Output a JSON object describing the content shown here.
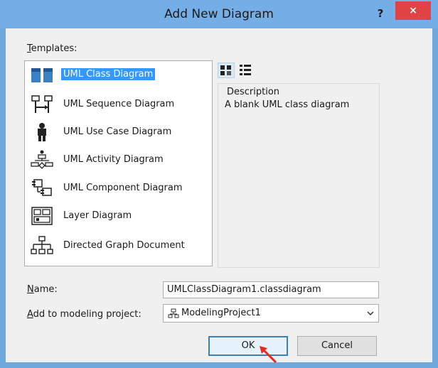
{
  "window": {
    "title": "Add New Diagram",
    "help": "?",
    "close": "×"
  },
  "templates": {
    "label_first": "T",
    "label_rest": "emplates:",
    "items": [
      {
        "label": "UML Class Diagram",
        "icon": "class-diagram-icon"
      },
      {
        "label": "UML Sequence Diagram",
        "icon": "sequence-diagram-icon"
      },
      {
        "label": "UML Use Case Diagram",
        "icon": "use-case-diagram-icon"
      },
      {
        "label": "UML Activity Diagram",
        "icon": "activity-diagram-icon"
      },
      {
        "label": "UML Component Diagram",
        "icon": "component-diagram-icon"
      },
      {
        "label": "Layer Diagram",
        "icon": "layer-diagram-icon"
      },
      {
        "label": "Directed Graph Document",
        "icon": "directed-graph-icon"
      }
    ],
    "selected_index": 0
  },
  "description": {
    "title": "Description",
    "text": "A blank UML class diagram"
  },
  "name": {
    "label_first": "N",
    "label_rest": "ame:",
    "value": "UMLClassDiagram1.classdiagram"
  },
  "project": {
    "label_first": "A",
    "label_rest": "dd to modeling project:",
    "value": "ModelingProject1"
  },
  "buttons": {
    "ok": "OK",
    "cancel": "Cancel"
  },
  "colors": {
    "selection": "#3399ff",
    "close": "#e04343",
    "titlebar": "#75aee6"
  }
}
